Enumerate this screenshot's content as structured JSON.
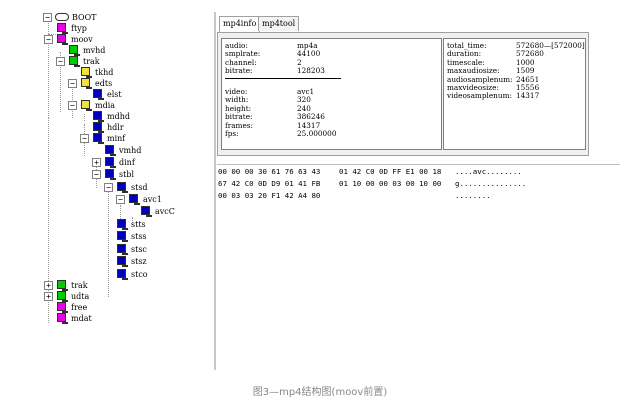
{
  "tree": {
    "root_label": "BOOT",
    "nodes": [
      {
        "label": "ftyp",
        "color": "#e800e8"
      },
      {
        "label": "moov",
        "color": "#e800e8"
      },
      {
        "label": "mvhd",
        "color": "#00cc00"
      },
      {
        "label": "trak",
        "color": "#00cc00"
      },
      {
        "label": "tkhd",
        "color": "#f0e040"
      },
      {
        "label": "edts",
        "color": "#f0e040"
      },
      {
        "label": "elst",
        "color": "#0000b8"
      },
      {
        "label": "mdia",
        "color": "#f0e040"
      },
      {
        "label": "mdhd",
        "color": "#0000b8"
      },
      {
        "label": "hdlr",
        "color": "#0000b8"
      },
      {
        "label": "minf",
        "color": "#0000b8"
      },
      {
        "label": "vmhd",
        "color": "#0000b8"
      },
      {
        "label": "dinf",
        "color": "#0000b8"
      },
      {
        "label": "stbl",
        "color": "#0000b8"
      },
      {
        "label": "stsd",
        "color": "#0000b8"
      },
      {
        "label": "avc1",
        "color": "#0000b8"
      },
      {
        "label": "avcC",
        "color": "#0000b8"
      },
      {
        "label": "stts",
        "color": "#0000b8"
      },
      {
        "label": "stss",
        "color": "#0000b8"
      },
      {
        "label": "stsc",
        "color": "#0000b8"
      },
      {
        "label": "stsz",
        "color": "#0000b8"
      },
      {
        "label": "stco",
        "color": "#0000b8"
      },
      {
        "label": "trak",
        "color": "#00cc00"
      },
      {
        "label": "udta",
        "color": "#00cc00"
      },
      {
        "label": "free",
        "color": "#e800e8"
      },
      {
        "label": "mdat",
        "color": "#e800e8"
      }
    ],
    "expanders": {
      "root": "−",
      "moov": "−",
      "trak1": "−",
      "edts": "−",
      "mdia": "−",
      "minf": "−",
      "dinf": "+",
      "stbl": "−",
      "stsd": "−",
      "avc1": "−",
      "trak2": "+",
      "udta": "+"
    }
  },
  "tabs": [
    {
      "label": "mp4info",
      "active": true
    },
    {
      "label": "mp4tool",
      "active": false
    }
  ],
  "info": {
    "audio": [
      {
        "k": "audio:",
        "v": "mp4a"
      },
      {
        "k": "smplrate:",
        "v": "44100"
      },
      {
        "k": "channel:",
        "v": "2"
      },
      {
        "k": "bitrate:",
        "v": "128203"
      }
    ],
    "video": [
      {
        "k": "video:",
        "v": "avc1"
      },
      {
        "k": "width:",
        "v": "320"
      },
      {
        "k": "height:",
        "v": "240"
      },
      {
        "k": "bitrate:",
        "v": "386246"
      },
      {
        "k": "frames:",
        "v": "14317"
      },
      {
        "k": "fps:",
        "v": "25.000000"
      }
    ],
    "right": [
      {
        "k": "total_time:",
        "v": "572680—[572000]"
      },
      {
        "k": "duration:",
        "v": "572680"
      },
      {
        "k": "timescale:",
        "v": "1000"
      },
      {
        "k": "maxaudiosize:",
        "v": "1509"
      },
      {
        "k": "audiosamplenum:",
        "v": "24651"
      },
      {
        "k": "maxvideosize:",
        "v": "15556"
      },
      {
        "k": "videosamplenum:",
        "v": "14317"
      }
    ]
  },
  "hex": [
    {
      "a": "00 00 00 30 61 76 63 43",
      "b": "01 42 C0 0D FF E1 00 18",
      "c": "....avc........"
    },
    {
      "a": "67 42 C0 0D D9 01 41 FB",
      "b": "01 10 00 00 03 00 10 00",
      "c": "g..............."
    },
    {
      "a": "00 03 03 20 F1 42 A4 80",
      "b": "",
      "c": "........"
    }
  ],
  "caption": "图3—mp4结构图(moov前置)"
}
